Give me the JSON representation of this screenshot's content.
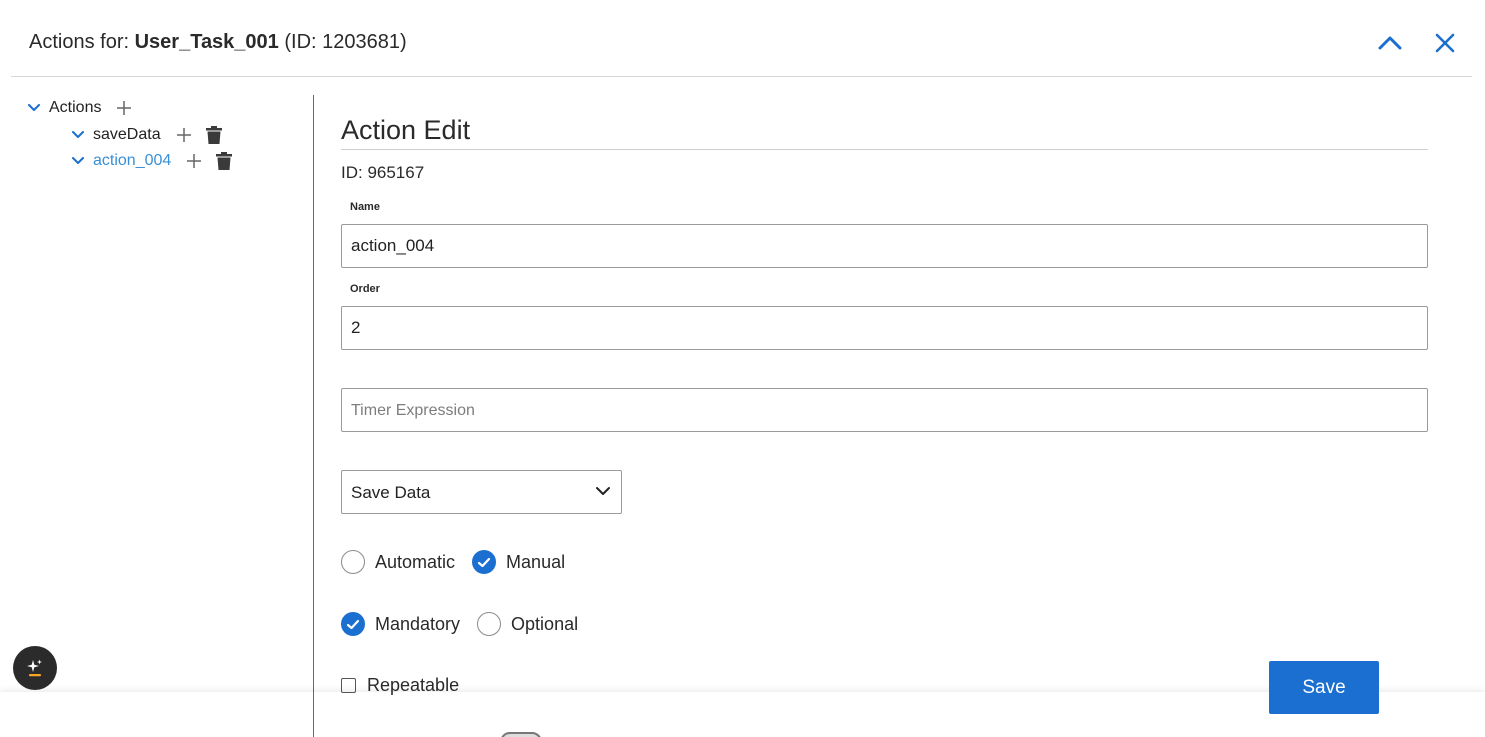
{
  "header": {
    "title_prefix": "Actions for: ",
    "task_name": "User_Task_001",
    "task_id_text": "(ID: 1203681)",
    "collapse_icon": "chevron-up-icon",
    "close_icon": "close-icon"
  },
  "tree": {
    "root": {
      "label": "Actions",
      "expanded": true
    },
    "items": [
      {
        "label": "saveData",
        "selected": false
      },
      {
        "label": "action_004",
        "selected": true
      }
    ]
  },
  "editor": {
    "title": "Action Edit",
    "id_text": "ID: 965167",
    "name": {
      "label": "Name",
      "value": "action_004"
    },
    "order": {
      "label": "Order",
      "value": "2"
    },
    "timer": {
      "placeholder": "Timer Expression",
      "value": ""
    },
    "action_type": {
      "selected": "Save Data"
    },
    "trigger": {
      "options": [
        {
          "label": "Automatic",
          "checked": false
        },
        {
          "label": "Manual",
          "checked": true
        }
      ]
    },
    "requirement": {
      "options": [
        {
          "label": "Mandatory",
          "checked": true
        },
        {
          "label": "Optional",
          "checked": false
        }
      ]
    },
    "repeatable": {
      "label": "Repeatable",
      "checked": false
    }
  },
  "footer": {
    "save_label": "Save"
  },
  "colors": {
    "accent": "#1a6fd0",
    "link": "#3a8fd6",
    "fab": "#2b2b2b",
    "fab_accent": "#f5a623"
  }
}
